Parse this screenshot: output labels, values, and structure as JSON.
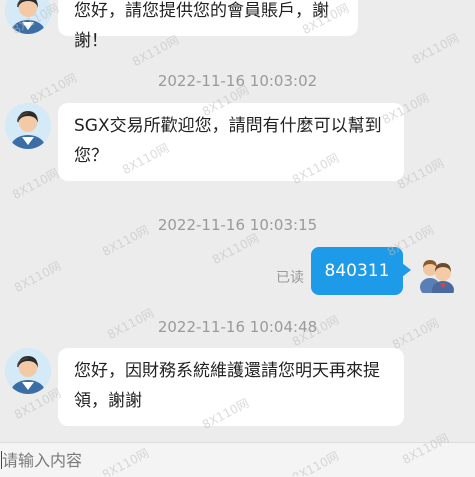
{
  "messages": [
    {
      "id": "m1",
      "type": "received",
      "text_lines": [
        "您好，請您提供您的會員賬戶，謝謝！"
      ],
      "avatar_icon": "agent-avatar-icon"
    },
    {
      "id": "t1",
      "type": "timestamp",
      "text": "2022-11-16 10:03:02"
    },
    {
      "id": "m2",
      "type": "received",
      "text_lines": [
        "SGX交易所歡迎您，請問有什麼可以幫到",
        "您？"
      ],
      "avatar_icon": "agent-avatar-icon"
    },
    {
      "id": "t2",
      "type": "timestamp",
      "text": "2022-11-16 10:03:15"
    },
    {
      "id": "m3",
      "type": "sent",
      "text": "840311",
      "status": "已读",
      "avatar_icon": "user-avatar-icon"
    },
    {
      "id": "t3",
      "type": "timestamp",
      "text": "2022-11-16 10:04:48"
    },
    {
      "id": "m4",
      "type": "received",
      "text_lines": [
        "您好，因財務系統維護還請您明天再來提",
        "領，謝謝"
      ],
      "avatar_icon": "agent-avatar-icon"
    }
  ],
  "input": {
    "placeholder": "请输入内容",
    "value": ""
  },
  "watermark": {
    "text": "8X110网"
  },
  "colors": {
    "sent_bubble": "#1e9be8",
    "received_bubble": "#ffffff",
    "background": "#ececec"
  }
}
